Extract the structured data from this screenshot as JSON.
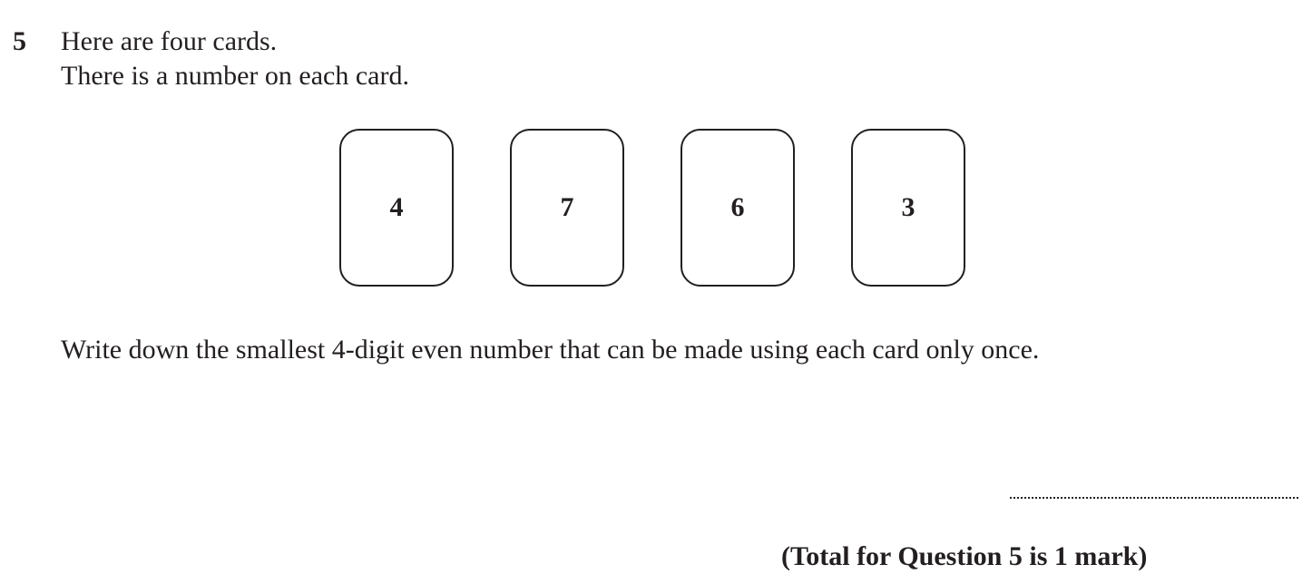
{
  "question": {
    "number": "5",
    "intro_line1": "Here are four cards.",
    "intro_line2": "There is a number on each card.",
    "cards": [
      "4",
      "7",
      "6",
      "3"
    ],
    "instruction": "Write down the smallest 4-digit even number that can be made using each card only once.",
    "total": "(Total for Question 5 is 1 mark)"
  }
}
